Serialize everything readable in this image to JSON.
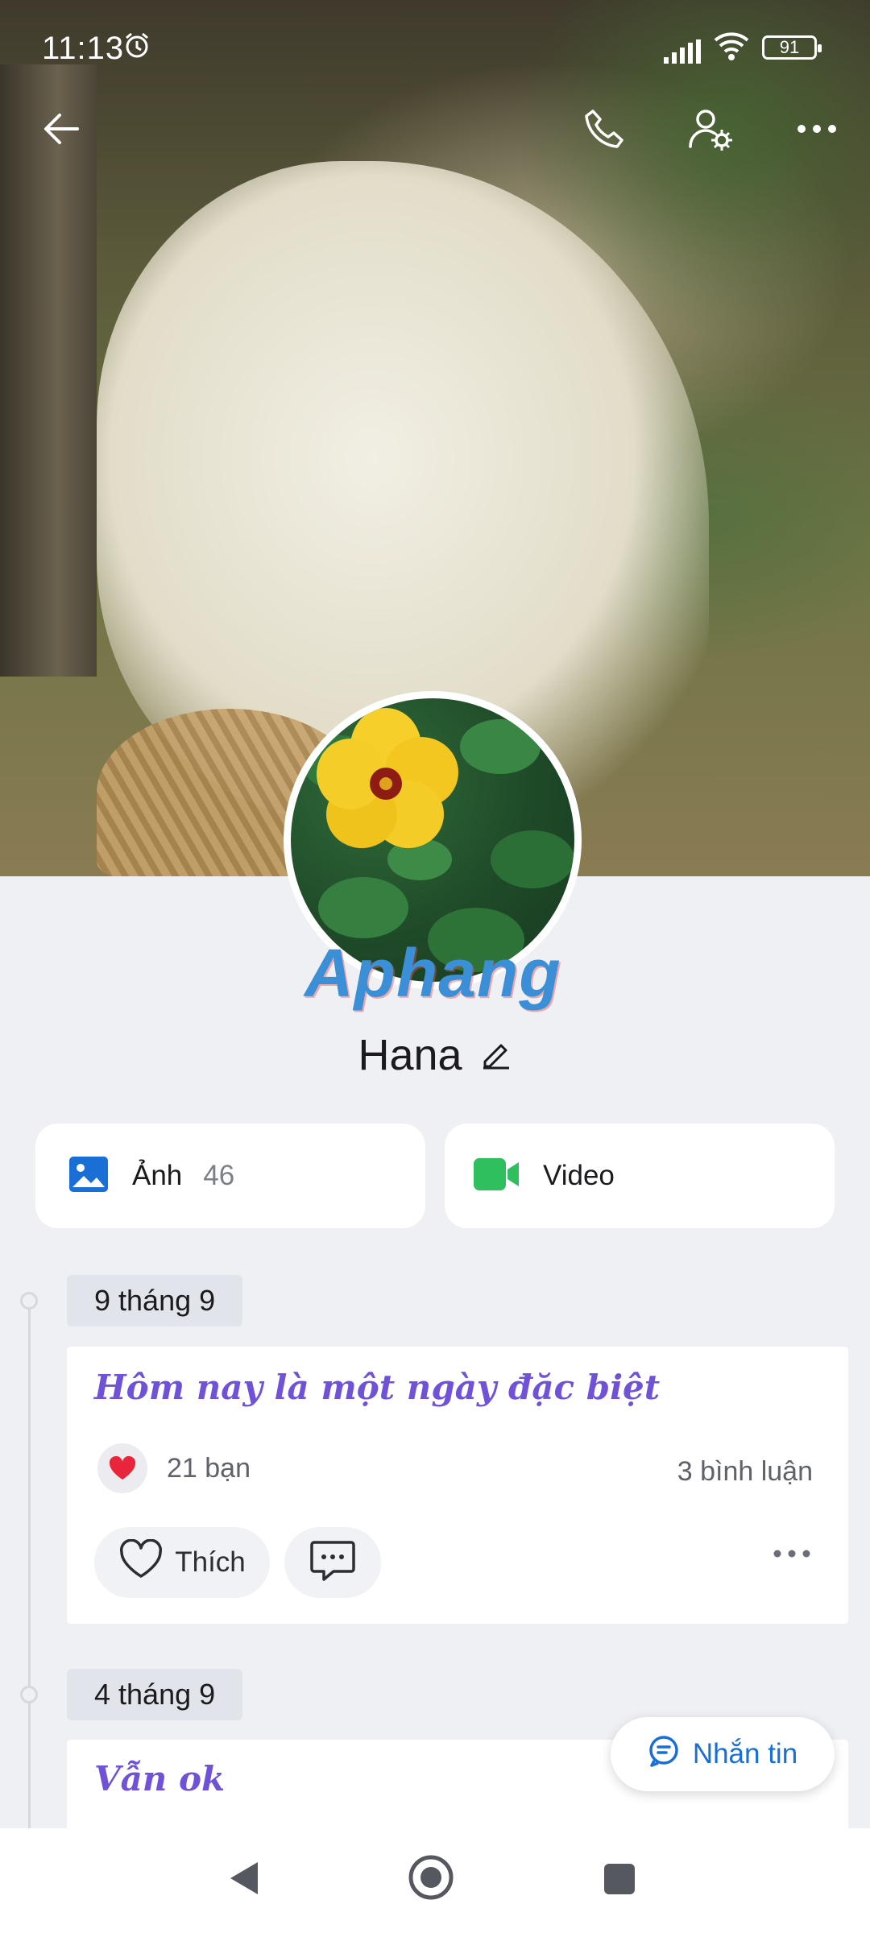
{
  "status_bar": {
    "time": "11:13",
    "battery": "91",
    "icons": [
      "alarm-icon",
      "signal-icon",
      "wifi-icon",
      "battery-icon"
    ]
  },
  "top_nav": {
    "icons": [
      "back-arrow-icon",
      "phone-call-icon",
      "user-settings-icon",
      "more-icon"
    ]
  },
  "profile": {
    "name": "Hana",
    "watermark": "Aphang"
  },
  "media_cards": [
    {
      "label": "Ảnh",
      "count": "46",
      "icon": "photo-icon"
    },
    {
      "label": "Video",
      "icon": "video-icon"
    }
  ],
  "timeline": [
    {
      "date": "9 tháng 9",
      "title": "Hôm nay là một ngày đặc biệt",
      "reactions": "21 bạn",
      "comments": "3 bình luận",
      "like_label": "Thích"
    },
    {
      "date": "4 tháng 9",
      "title": "Vẫn ok"
    }
  ],
  "floating_button": {
    "label": "Nhắn tin",
    "icon": "chat-icon"
  },
  "colors": {
    "accent_blue": "#1a6fd6",
    "title_purple": "#6f52d8",
    "page_bg": "#eef0f4",
    "heart_red": "#e8253a",
    "video_green": "#2fbf5e"
  },
  "system_nav": [
    "back-triangle-icon",
    "home-circle-icon",
    "recents-square-icon"
  ]
}
